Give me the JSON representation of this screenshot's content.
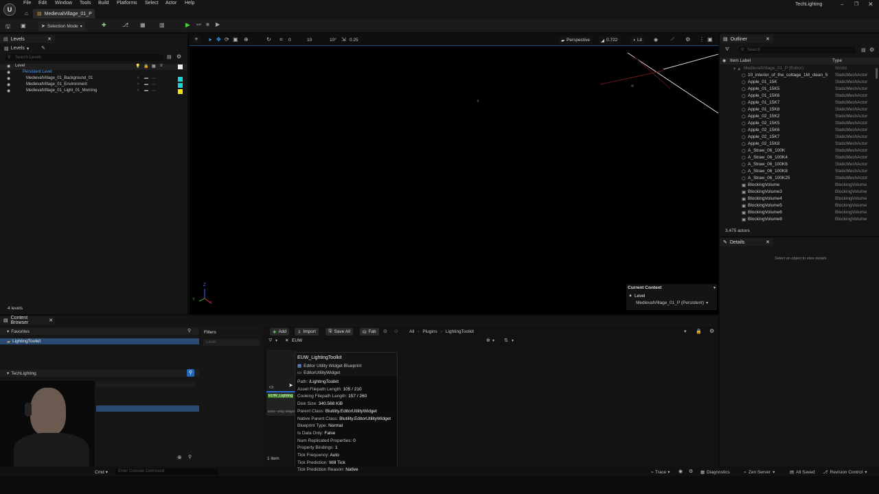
{
  "menubar": {
    "items": [
      "File",
      "Edit",
      "Window",
      "Tools",
      "Build",
      "Platforms",
      "Select",
      "Actor",
      "Help"
    ],
    "tab_title": "MedievalVillage_01_P",
    "project_name": "TechLighting"
  },
  "toolbar": {
    "selection_mode": "Selection Mode"
  },
  "levels": {
    "tab_label": "Levels",
    "dropdown_label": "Levels",
    "search_placeholder": "Search Levels",
    "column_header": "Level",
    "persistent": "Persistent Level",
    "sublevels": [
      {
        "name": "MedievalVillage_01_Background_01",
        "color": "#1fd3d6"
      },
      {
        "name": "MedievalVillage_01_Environment",
        "color": "#1fd3d6"
      },
      {
        "name": "MedievalVillage_01_Light_01_Morning",
        "color": "#f2e21a"
      }
    ],
    "count": "4 levels"
  },
  "viewport": {
    "perspective": "Perspective",
    "fov": "0.722",
    "lit": "Lit",
    "grid_values": [
      "0",
      "10",
      "10°",
      "0.25"
    ],
    "context_title": "Current Context",
    "context_level_label": "Level",
    "context_value": "MedievalVillage_01_P (Persistent)"
  },
  "outliner": {
    "tab_label": "Outliner",
    "search_placeholder": "Search",
    "col_label": "Item Label",
    "col_type": "Type",
    "root": {
      "label": "MedievalVillage_01_P (Editor)",
      "type": "World"
    },
    "rows": [
      {
        "label": "10_interior_of_the_cottage_1M_clean_5",
        "type": "StaticMeshActor"
      },
      {
        "label": "Apple_01_15K",
        "type": "StaticMeshActor"
      },
      {
        "label": "Apple_01_15K5",
        "type": "StaticMeshActor"
      },
      {
        "label": "Apple_01_15K6",
        "type": "StaticMeshActor"
      },
      {
        "label": "Apple_01_15K7",
        "type": "StaticMeshActor"
      },
      {
        "label": "Apple_01_15K8",
        "type": "StaticMeshActor"
      },
      {
        "label": "Apple_02_15K2",
        "type": "StaticMeshActor"
      },
      {
        "label": "Apple_02_15K5",
        "type": "StaticMeshActor"
      },
      {
        "label": "Apple_02_15K6",
        "type": "StaticMeshActor"
      },
      {
        "label": "Apple_02_15K7",
        "type": "StaticMeshActor"
      },
      {
        "label": "Apple_02_15K8",
        "type": "StaticMeshActor"
      },
      {
        "label": "A_Straw_06_100K",
        "type": "StaticMeshActor"
      },
      {
        "label": "A_Straw_06_100K4",
        "type": "StaticMeshActor"
      },
      {
        "label": "A_Straw_06_100K6",
        "type": "StaticMeshActor"
      },
      {
        "label": "A_Straw_06_100K8",
        "type": "StaticMeshActor"
      },
      {
        "label": "A_Straw_06_100K25",
        "type": "StaticMeshActor"
      },
      {
        "label": "BlockingVolume",
        "type": "BlockingVolume"
      },
      {
        "label": "BlockingVolume3",
        "type": "BlockingVolume"
      },
      {
        "label": "BlockingVolume4",
        "type": "BlockingVolume"
      },
      {
        "label": "BlockingVolume5",
        "type": "BlockingVolume"
      },
      {
        "label": "BlockingVolume6",
        "type": "BlockingVolume"
      },
      {
        "label": "BlockingVolume8",
        "type": "BlockingVolume"
      }
    ],
    "count": "3,475 actors"
  },
  "details": {
    "tab_label": "Details",
    "empty_text": "Select an object to view details."
  },
  "content_browser": {
    "tab_label": "Content Browser",
    "favorites_label": "Favorites",
    "favorite_item": "LightingToolkit",
    "project_label": "TechLighting",
    "filters_label": "Filters",
    "filter_placeholder": "Level",
    "add_label": "Add",
    "import_label": "Import",
    "save_all_label": "Save All",
    "fab_label": "Fab",
    "breadcrumb": [
      "All",
      "Plugins",
      "LightingToolkit"
    ],
    "search_value": "EUW",
    "asset_label": "EUW_Lighting",
    "asset_sub": "Editor Utility Widget",
    "item_count": "1 item"
  },
  "tooltip": {
    "title": "EUW_LightingToolkit",
    "type_line": "Editor Utility Widget Blueprint",
    "class_line": "EditorUtilityWidget",
    "rows": [
      {
        "k": "Path:",
        "v": "/LightingToolkit"
      },
      {
        "k": "Asset Filepath Length:",
        "v": "105 / 210"
      },
      {
        "k": "Cooking Filepath Length:",
        "v": "157 / 260"
      },
      {
        "k": "Disk Size:",
        "v": "340.568 KiB"
      },
      {
        "k": "Parent Class:",
        "v": "Blutility.EditorUtilityWidget"
      },
      {
        "k": "Native Parent Class:",
        "v": "Blutility.EditorUtilityWidget"
      },
      {
        "k": "Blueprint Type:",
        "v": "Normal"
      },
      {
        "k": "Is Data Only:",
        "v": "False"
      },
      {
        "k": "Num Replicated Properties:",
        "v": "0"
      },
      {
        "k": "Property Bindings:",
        "v": "1"
      },
      {
        "k": "Tick Frequency:",
        "v": "Auto"
      },
      {
        "k": "Tick Prediction:",
        "v": "Will Tick"
      },
      {
        "k": "Tick Prediction Reason:",
        "v": "Native"
      }
    ]
  },
  "statusbar": {
    "cmd": "Cmd",
    "console_placeholder": "Enter Console Command",
    "trace": "Trace",
    "derived_data": "Diagnostics",
    "zen_server": "Zen Server",
    "all_saved": "All Saved",
    "revision": "Revision Control"
  }
}
